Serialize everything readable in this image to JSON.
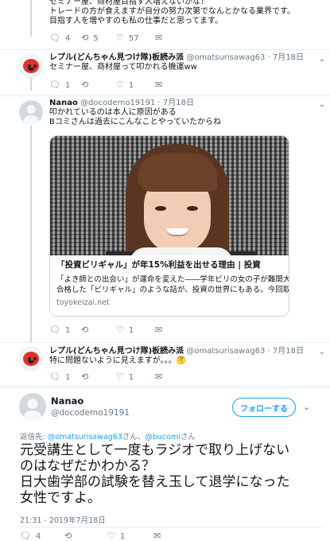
{
  "tweets": [
    {
      "text_lines": [
        "セミナー屋、商材屋目指す人増えないかな？",
        "トレードの方が食えますが自分の努力次第でなんとかなる業界です。",
        "目指す人を増やすのも私の仕事だと思ってます。"
      ],
      "actions": {
        "reply": "4",
        "retweet": "5",
        "like": "57"
      }
    },
    {
      "name": "レプル(どんちゃん見つけ隊)板読み派",
      "handle": "@omatsurisawag63",
      "date": "· 7月18日",
      "text_lines": [
        "セミナー屋、商材屋って叩かれる機運ww"
      ],
      "actions": {
        "reply": "1",
        "retweet": "",
        "like": "1"
      }
    },
    {
      "name": "Nanao",
      "handle": "@docodemo19191",
      "date": "· 7月18日",
      "text_lines": [
        "叩かれているのは本人に原因がある",
        "Bコミさんは過去にこんなことやっていたからね"
      ],
      "card": {
        "title": "「投資ビリギャル」が年15%利益を出せる理由 | 投資",
        "desc_lines": [
          "「よき師との出会い」が運命を変えた――学年ビリの女の子が難関大学に",
          "合格した「ビリギャル」のような話が、投資の世界にもある。今回取..."
        ],
        "domain": "toyokeizai.net"
      },
      "actions": {
        "reply": "1",
        "retweet": "",
        "like": "1"
      }
    },
    {
      "name": "レプル(どんちゃん見つけ隊)板読み派",
      "handle": "@omatsurisawag63",
      "date": "· 7月18日",
      "text_lines": [
        "特に問題ないように見えますが。。。🤔"
      ],
      "actions": {
        "reply": "1",
        "retweet": "",
        "like": "1"
      }
    }
  ],
  "main_tweet": {
    "name": "Nanao",
    "handle": "@docodemo19191",
    "follow_label": "フォローする",
    "reply_prefix": "返信先: ",
    "reply_user1": "@omatsurisawag63",
    "reply_mid": "さん、",
    "reply_user2": "@bucomi",
    "reply_suffix": "さん",
    "text_lines": [
      "元受講生として一度もラジオで取り上げない",
      "のはなぜだかわかる？",
      "日大歯学部の試験を替え玉して退学になった",
      "女性ですよ。"
    ],
    "timestamp": "21:31 - 2019年7月18日",
    "actions": {
      "reply": "4",
      "retweet": "",
      "like": "1"
    }
  },
  "icons": {
    "reply": "reply-icon",
    "retweet": "retweet-icon",
    "like": "heart-icon",
    "dm": "envelope-icon",
    "more": "chevron-down-icon"
  },
  "colors": {
    "accent": "#1da1f2",
    "muted": "#657786",
    "text": "#14171a",
    "line": "#ccd6dd"
  }
}
